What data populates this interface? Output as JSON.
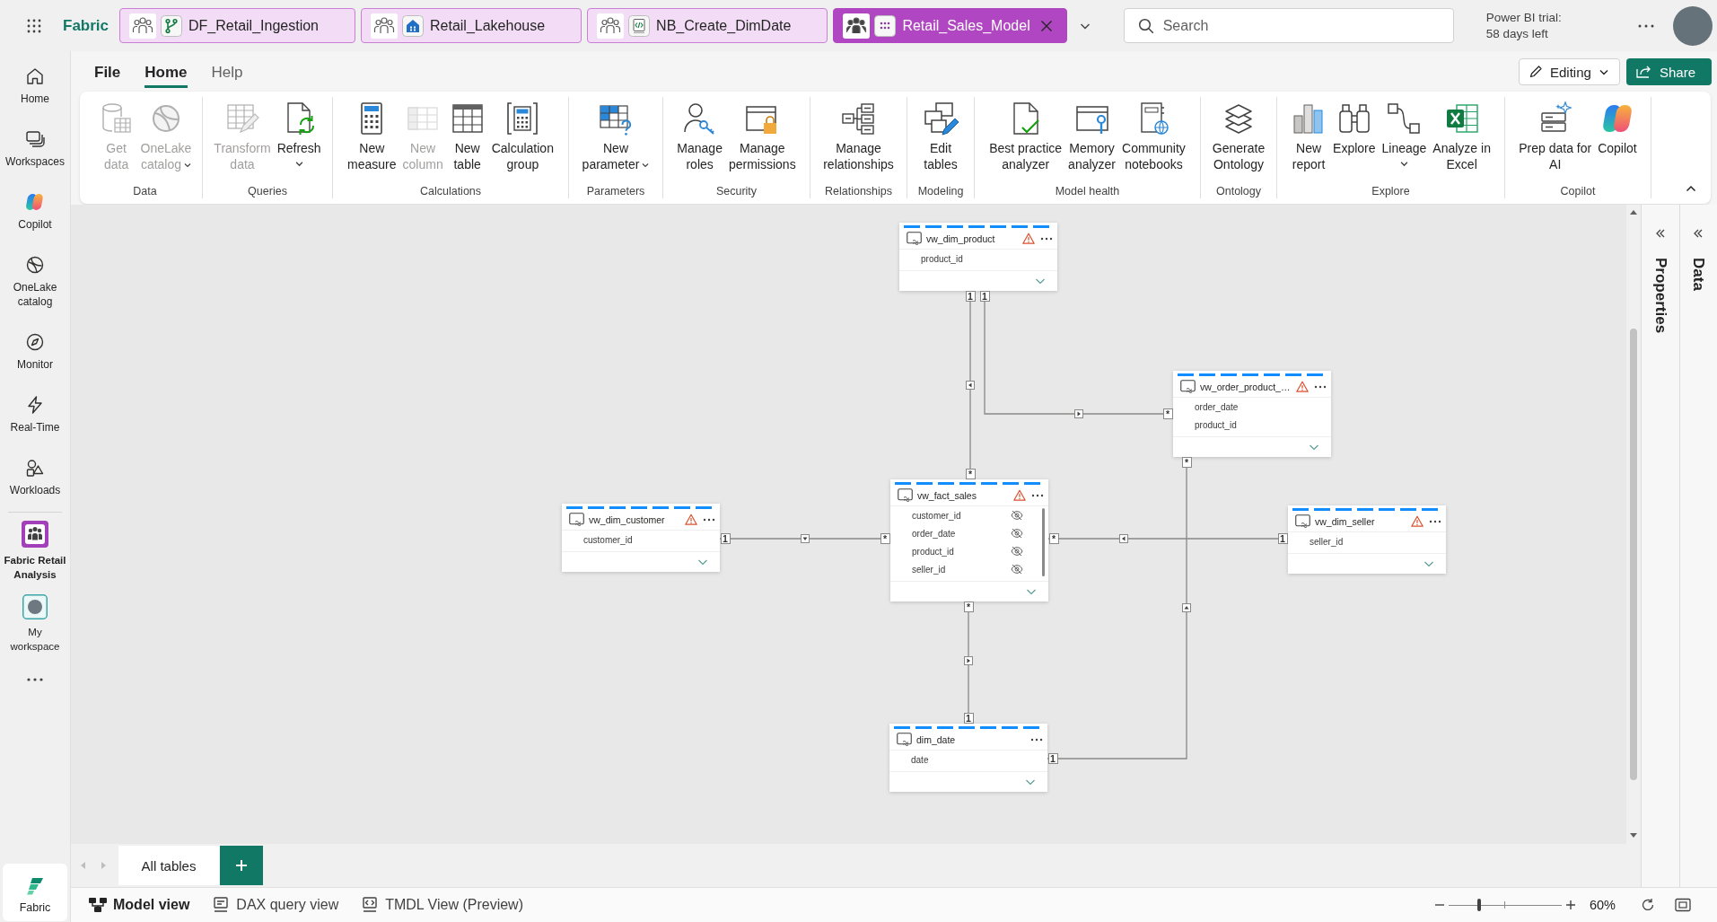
{
  "header": {
    "app_name": "Fabric",
    "tabs": [
      {
        "name": "DF_Retail_Ingestion",
        "kind": "dataflow",
        "selected": false
      },
      {
        "name": "Retail_Lakehouse",
        "kind": "lakehouse",
        "selected": false
      },
      {
        "name": "NB_Create_DimDate",
        "kind": "notebook",
        "selected": false
      },
      {
        "name": "Retail_Sales_Model",
        "kind": "semantic_model",
        "selected": true
      }
    ],
    "search": {
      "placeholder": "Search"
    },
    "trial_notice": "Power BI trial: 58 days left"
  },
  "nav": {
    "items": [
      {
        "label": "Home",
        "selected": false
      },
      {
        "label": "Workspaces",
        "selected": false
      },
      {
        "label": "Copilot",
        "selected": false
      },
      {
        "label": "OneLake catalog",
        "selected": false
      },
      {
        "label": "Monitor",
        "selected": false
      },
      {
        "label": "Real-Time",
        "selected": false
      },
      {
        "label": "Workloads",
        "selected": false
      }
    ],
    "workspaces": [
      {
        "label": "Fabric Retail Analysis",
        "selected": true
      },
      {
        "label": "My workspace",
        "selected": false
      }
    ],
    "footer": {
      "label": "Fabric"
    }
  },
  "ribbon": {
    "tabs": [
      {
        "label": "File",
        "kind": "menu",
        "selected": false
      },
      {
        "label": "Home",
        "kind": "tab",
        "selected": true
      },
      {
        "label": "Help",
        "kind": "tab",
        "selected": false
      }
    ],
    "mode_button": {
      "label": "Editing"
    },
    "share_button": {
      "label": "Share"
    },
    "groups": [
      {
        "label": "Data",
        "buttons": [
          {
            "label": "Get data",
            "disabled": true,
            "dropdown": false
          },
          {
            "label": "OneLake catalog",
            "disabled": true,
            "dropdown": true
          }
        ]
      },
      {
        "label": "Queries",
        "buttons": [
          {
            "label": "Transform data",
            "disabled": true,
            "dropdown": false
          },
          {
            "label": "Refresh",
            "disabled": false,
            "dropdown": true
          }
        ]
      },
      {
        "label": "Calculations",
        "buttons": [
          {
            "label": "New measure",
            "disabled": false,
            "dropdown": false
          },
          {
            "label": "New column",
            "disabled": true,
            "dropdown": false
          },
          {
            "label": "New table",
            "disabled": false,
            "dropdown": false
          },
          {
            "label": "Calculation group",
            "disabled": false,
            "dropdown": false
          }
        ]
      },
      {
        "label": "Parameters",
        "buttons": [
          {
            "label": "New parameter",
            "disabled": false,
            "dropdown": true
          }
        ]
      },
      {
        "label": "Security",
        "buttons": [
          {
            "label": "Manage roles",
            "disabled": false,
            "dropdown": false
          },
          {
            "label": "Manage permissions",
            "disabled": false,
            "dropdown": false
          }
        ]
      },
      {
        "label": "Relationships",
        "buttons": [
          {
            "label": "Manage relationships",
            "disabled": false,
            "dropdown": false
          }
        ]
      },
      {
        "label": "Modeling",
        "buttons": [
          {
            "label": "Edit tables",
            "disabled": false,
            "dropdown": false
          }
        ]
      },
      {
        "label": "Model health",
        "buttons": [
          {
            "label": "Best practice analyzer",
            "disabled": false,
            "dropdown": false
          },
          {
            "label": "Memory analyzer",
            "disabled": false,
            "dropdown": false
          },
          {
            "label": "Community notebooks",
            "disabled": false,
            "dropdown": false
          }
        ]
      },
      {
        "label": "Ontology",
        "buttons": [
          {
            "label": "Generate Ontology",
            "disabled": false,
            "dropdown": false
          }
        ]
      },
      {
        "label": "Explore",
        "buttons": [
          {
            "label": "New report",
            "disabled": false,
            "dropdown": false
          },
          {
            "label": "Explore",
            "disabled": false,
            "dropdown": false
          },
          {
            "label": "Lineage",
            "disabled": false,
            "dropdown": true
          },
          {
            "label": "Analyze in Excel",
            "disabled": false,
            "dropdown": false
          }
        ]
      },
      {
        "label": "Copilot",
        "buttons": [
          {
            "label": "Prep data for AI",
            "disabled": false,
            "dropdown": false
          },
          {
            "label": "Copilot",
            "disabled": false,
            "dropdown": false
          }
        ]
      }
    ]
  },
  "model": {
    "tables": [
      {
        "name": "vw_dim_product",
        "warning": true,
        "columns": [
          {
            "name": "product_id",
            "hidden": false
          }
        ]
      },
      {
        "name": "vw_order_product_…",
        "warning": true,
        "columns": [
          {
            "name": "order_date",
            "hidden": false
          },
          {
            "name": "product_id",
            "hidden": false
          }
        ]
      },
      {
        "name": "vw_dim_customer",
        "warning": true,
        "columns": [
          {
            "name": "customer_id",
            "hidden": false
          }
        ]
      },
      {
        "name": "vw_fact_sales",
        "warning": true,
        "columns": [
          {
            "name": "customer_id",
            "hidden": true
          },
          {
            "name": "order_date",
            "hidden": true
          },
          {
            "name": "product_id",
            "hidden": true
          },
          {
            "name": "seller_id",
            "hidden": true
          }
        ]
      },
      {
        "name": "vw_dim_seller",
        "warning": true,
        "columns": [
          {
            "name": "seller_id",
            "hidden": false
          }
        ]
      },
      {
        "name": "dim_date",
        "warning": false,
        "columns": [
          {
            "name": "date",
            "hidden": false
          }
        ]
      }
    ],
    "relationships": [
      {
        "one_end": "1",
        "many_end": "*"
      },
      {
        "one_end": "1",
        "many_end": "*"
      },
      {
        "one_end": "1",
        "many_end": "*"
      },
      {
        "one_end": "1",
        "many_end": "*"
      },
      {
        "one_end": "1",
        "many_end": "*"
      },
      {
        "one_end": "1",
        "many_end": "*"
      }
    ]
  },
  "layout_tabs": [
    {
      "label": "All tables",
      "selected": true
    }
  ],
  "side_panes": [
    {
      "label": "Properties"
    },
    {
      "label": "Data"
    }
  ],
  "views": [
    {
      "label": "Model view",
      "selected": true
    },
    {
      "label": "DAX query view",
      "selected": false
    },
    {
      "label": "TMDL View (Preview)",
      "selected": false
    }
  ],
  "zoom": {
    "level": 0.27,
    "reading": "60%"
  }
}
